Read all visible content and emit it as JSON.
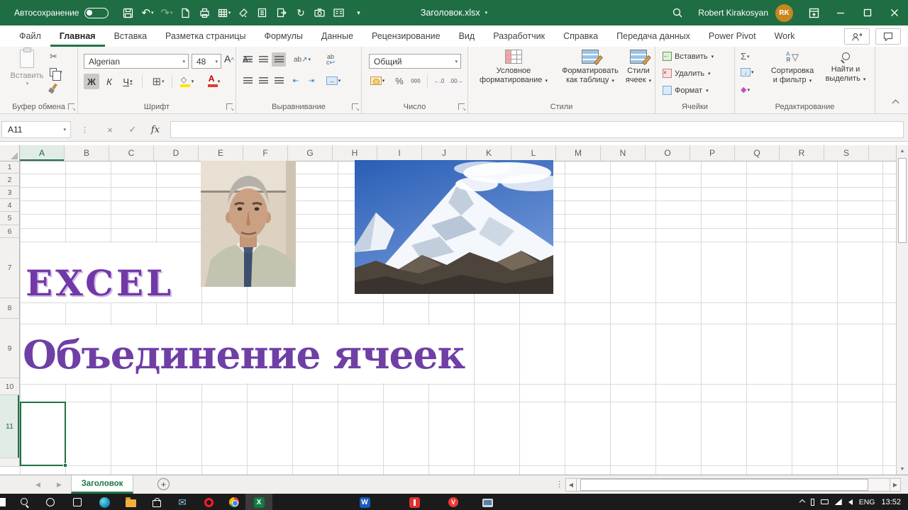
{
  "colors": {
    "titlebar_green": "#1F6E43",
    "accent_green": "#217346",
    "purple_text": "#7138A8",
    "avatar_gold": "#C8861E",
    "fill_yellow": "#FFE400",
    "font_red": "#E03C31"
  },
  "title_bar": {
    "autosave_label": "Автосохранение",
    "document_title": "Заголовок.xlsx",
    "user_name": "Robert Kirakosyan",
    "user_initials": "RK"
  },
  "ribbon_tabs": [
    {
      "label": "Файл"
    },
    {
      "label": "Главная",
      "active": true
    },
    {
      "label": "Вставка"
    },
    {
      "label": "Разметка страницы"
    },
    {
      "label": "Формулы"
    },
    {
      "label": "Данные"
    },
    {
      "label": "Рецензирование"
    },
    {
      "label": "Вид"
    },
    {
      "label": "Разработчик"
    },
    {
      "label": "Справка"
    },
    {
      "label": "Передача данных"
    },
    {
      "label": "Power Pivot"
    },
    {
      "label": "Work"
    }
  ],
  "ribbon": {
    "clipboard": {
      "group_label": "Буфер обмена",
      "paste_label": "Вставить"
    },
    "font": {
      "group_label": "Шрифт",
      "font_name": "Algerian",
      "font_size": "48",
      "bold": "Ж",
      "italic": "К",
      "underline": "Ч",
      "grow": "A",
      "shrink": "A",
      "color_letter": "А"
    },
    "alignment": {
      "group_label": "Выравнивание"
    },
    "number": {
      "group_label": "Число",
      "format": "Общий",
      "percent": "%",
      "thousands": "000"
    },
    "styles": {
      "group_label": "Стили",
      "conditional_1": "Условное",
      "conditional_2": "форматирование",
      "table_1": "Форматировать",
      "table_2": "как таблицу",
      "cellstyles_1": "Стили",
      "cellstyles_2": "ячеек"
    },
    "cells": {
      "group_label": "Ячейки",
      "insert": "Вставить",
      "delete": "Удалить",
      "format": "Формат"
    },
    "editing": {
      "group_label": "Редактирование",
      "autosum": "Σ",
      "sort_1": "Сортировка",
      "sort_2": "и фильтр",
      "find_1": "Найти и",
      "find_2": "выделить"
    }
  },
  "formula_bar": {
    "name_box": "A11",
    "fx_label": "fx"
  },
  "grid": {
    "columns": [
      {
        "label": "A",
        "selected": true
      },
      {
        "label": "B"
      },
      {
        "label": "C"
      },
      {
        "label": "D"
      },
      {
        "label": "E"
      },
      {
        "label": "F"
      },
      {
        "label": "G"
      },
      {
        "label": "H"
      },
      {
        "label": "I"
      },
      {
        "label": "J"
      },
      {
        "label": "K"
      },
      {
        "label": "L"
      },
      {
        "label": "M"
      },
      {
        "label": "N"
      },
      {
        "label": "O"
      },
      {
        "label": "P"
      },
      {
        "label": "Q"
      },
      {
        "label": "R"
      },
      {
        "label": "S"
      }
    ],
    "rows": [
      {
        "label": "1"
      },
      {
        "label": "2"
      },
      {
        "label": "3"
      },
      {
        "label": "4"
      },
      {
        "label": "5"
      },
      {
        "label": "6"
      },
      {
        "label": "7"
      },
      {
        "label": "8"
      },
      {
        "label": "9"
      },
      {
        "label": "10"
      },
      {
        "label": "11",
        "selected": true
      }
    ],
    "cell_text_excel": "EXCEL",
    "cell_text_merge": "Объединение ячеек"
  },
  "sheet_bar": {
    "active_tab": "Заголовок"
  },
  "taskbar": {
    "language": "ENG",
    "time": "13:52"
  }
}
